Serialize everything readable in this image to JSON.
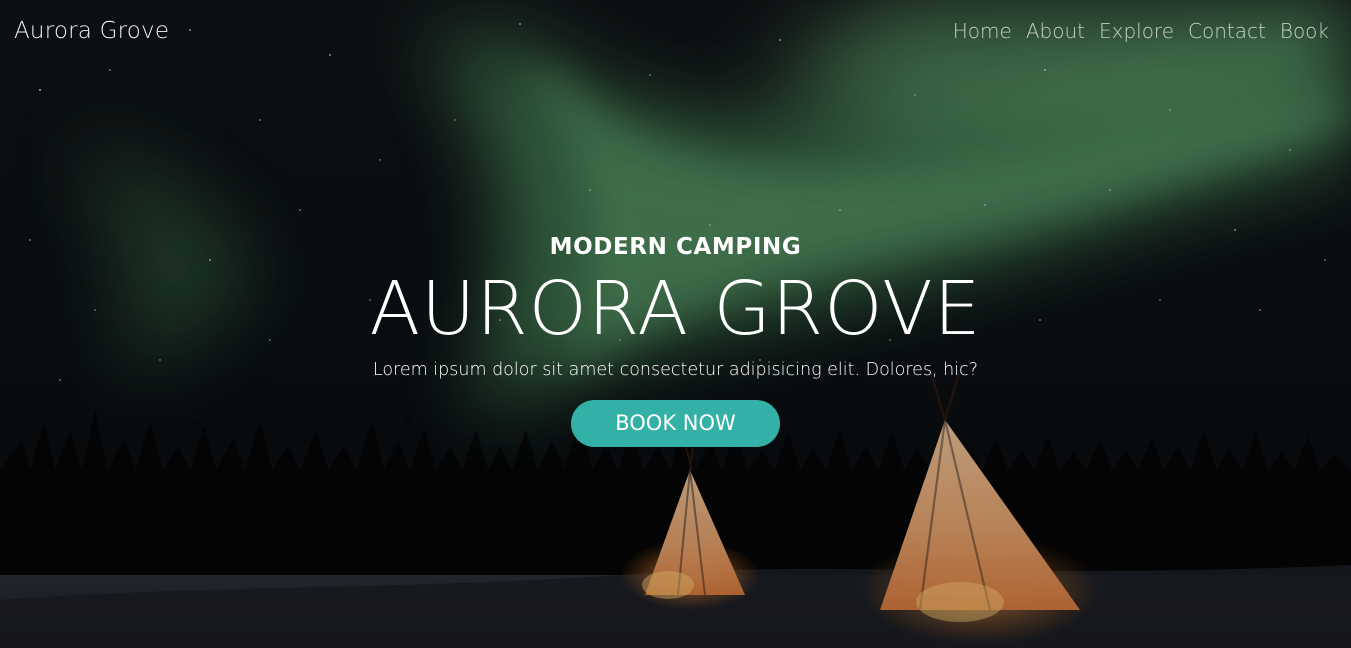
{
  "nav": {
    "brand": "Aurora Grove",
    "links": [
      "Home",
      "About",
      "Explore",
      "Contact",
      "Book"
    ]
  },
  "hero": {
    "eyebrow": "MODERN CAMPING",
    "title": "AURORA GROVE",
    "lead": "Lorem ipsum dolor sit amet consectetur adipisicing elit. Dolores, hic?",
    "cta_label": "BOOK NOW"
  },
  "colors": {
    "accent": "#33b1a6",
    "text": "#ffffff",
    "aurora": "#6fbf7a",
    "night": "#0b0f14"
  }
}
